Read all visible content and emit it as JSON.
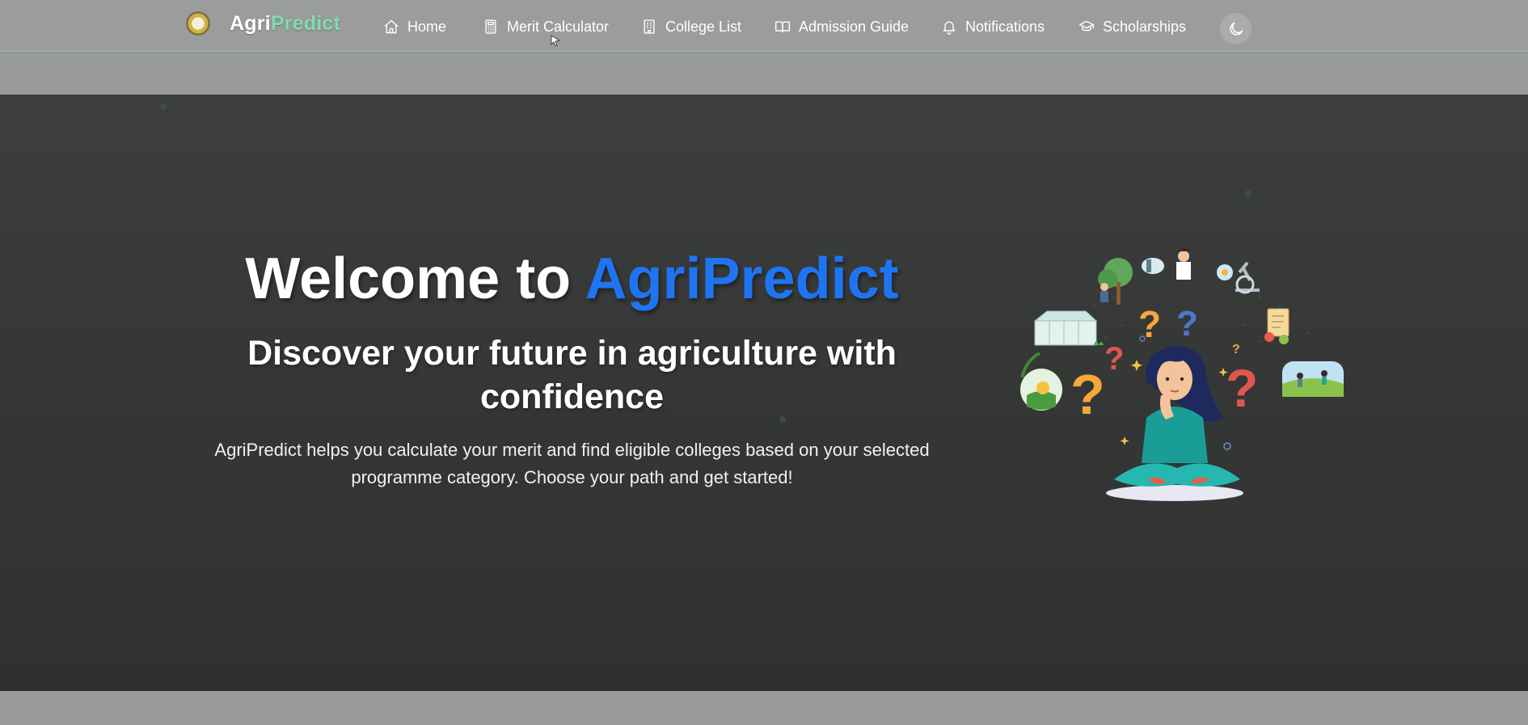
{
  "brand": {
    "name_part1": "Agri",
    "name_part2": "Predict",
    "logo_icon": "university-seal-icon"
  },
  "nav": {
    "items": [
      {
        "label": "Home",
        "icon": "home-icon"
      },
      {
        "label": "Merit Calculator",
        "icon": "calculator-icon"
      },
      {
        "label": "College List",
        "icon": "building-icon"
      },
      {
        "label": "Admission Guide",
        "icon": "book-icon"
      },
      {
        "label": "Notifications",
        "icon": "bell-icon"
      },
      {
        "label": "Scholarships",
        "icon": "graduation-cap-icon"
      }
    ],
    "theme_toggle_icon": "moon-icon"
  },
  "hero": {
    "title_prefix": "Welcome to ",
    "title_accent": "AgriPredict",
    "subtitle": "Discover your future in agriculture with confidence",
    "description": "AgriPredict helps you calculate your merit and find eligible colleges based on your selected programme category. Choose your path and get started!",
    "illustration": "thinking-student-agriculture-illustration"
  },
  "colors": {
    "navbar_bg": "#9a9d9c",
    "brand_accent": "#7fdcb0",
    "hero_bg": "#383a39",
    "hero_accent": "#1f74f2",
    "page_bg": "#999c9b"
  }
}
